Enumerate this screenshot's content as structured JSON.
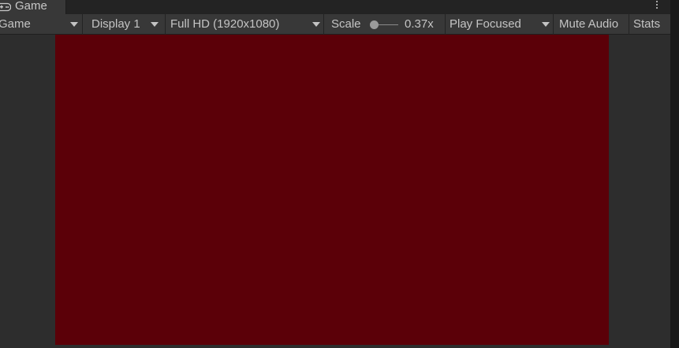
{
  "tab": {
    "label": "Game",
    "icon": "gamepad-icon"
  },
  "menu": {
    "icon": "kebab-menu-icon"
  },
  "toolbar": {
    "view_mode": "Game",
    "display": "Display 1",
    "resolution": "Full HD (1920x1080)",
    "scale_label": "Scale",
    "scale_value": "0.37x",
    "play_mode": "Play Focused",
    "mute_audio": "Mute Audio",
    "stats": "Stats"
  },
  "colors": {
    "game_background": "#5b0008",
    "panel_background": "#2d2d2d",
    "toolbar_background": "#383838"
  }
}
